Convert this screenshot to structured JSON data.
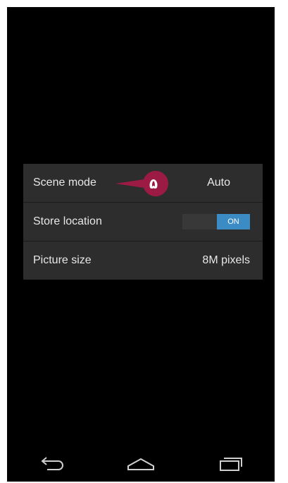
{
  "settings": {
    "items": [
      {
        "label": "Scene mode",
        "value": "Auto"
      },
      {
        "label": "Store location",
        "toggle_label": "ON",
        "toggle_state": "on"
      },
      {
        "label": "Picture size",
        "value": "8M pixels"
      }
    ]
  },
  "callout": {
    "number": "۵",
    "color": "#9b1b45"
  },
  "colors": {
    "background": "#000000",
    "panel": "#2d2d2d",
    "toggle_on": "#3b8bc4",
    "text": "#e8e8e8"
  },
  "navbar": {
    "icons": [
      "back-icon",
      "home-icon",
      "recent-apps-icon"
    ]
  }
}
